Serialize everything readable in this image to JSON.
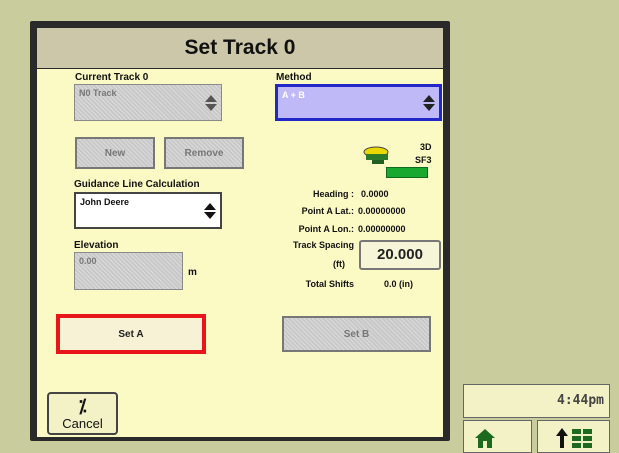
{
  "dialog": {
    "title": "Set Track 0",
    "current_track": {
      "label": "Current Track 0",
      "value": "N0 Track"
    },
    "method": {
      "label": "Method",
      "value": "A + B"
    },
    "buttons": {
      "new": "New",
      "remove": "Remove",
      "set_a": "Set A",
      "set_b": "Set B"
    },
    "guidance": {
      "label": "Guidance Line Calculation",
      "value": "John Deere"
    },
    "elevation": {
      "label": "Elevation",
      "value": "0.00",
      "unit": "m"
    },
    "receiver": {
      "mode": "3D",
      "signal": "SF3"
    },
    "heading": {
      "label": "Heading :",
      "value": "0.0000"
    },
    "point_a_lat": {
      "label": "Point A Lat.:",
      "value": "0.00000000"
    },
    "point_a_lon": {
      "label": "Point A Lon.:",
      "value": "0.00000000"
    },
    "track_spacing": {
      "label_line1": "Track Spacing",
      "label_line2": "(ft)",
      "value": "20.000"
    },
    "total_shifts": {
      "label": "Total Shifts",
      "value": "0.0 (in)"
    }
  },
  "cancel": {
    "label": "Cancel"
  },
  "clock": {
    "time": "4:44pm"
  },
  "colors": {
    "highlight_red": "#e8161a",
    "method_blue": "#2227c8",
    "status_green": "#18a830"
  },
  "icons": [
    "spin-icon",
    "gps-receiver-icon",
    "cancel-icon",
    "home-icon",
    "menu-up-icon"
  ]
}
